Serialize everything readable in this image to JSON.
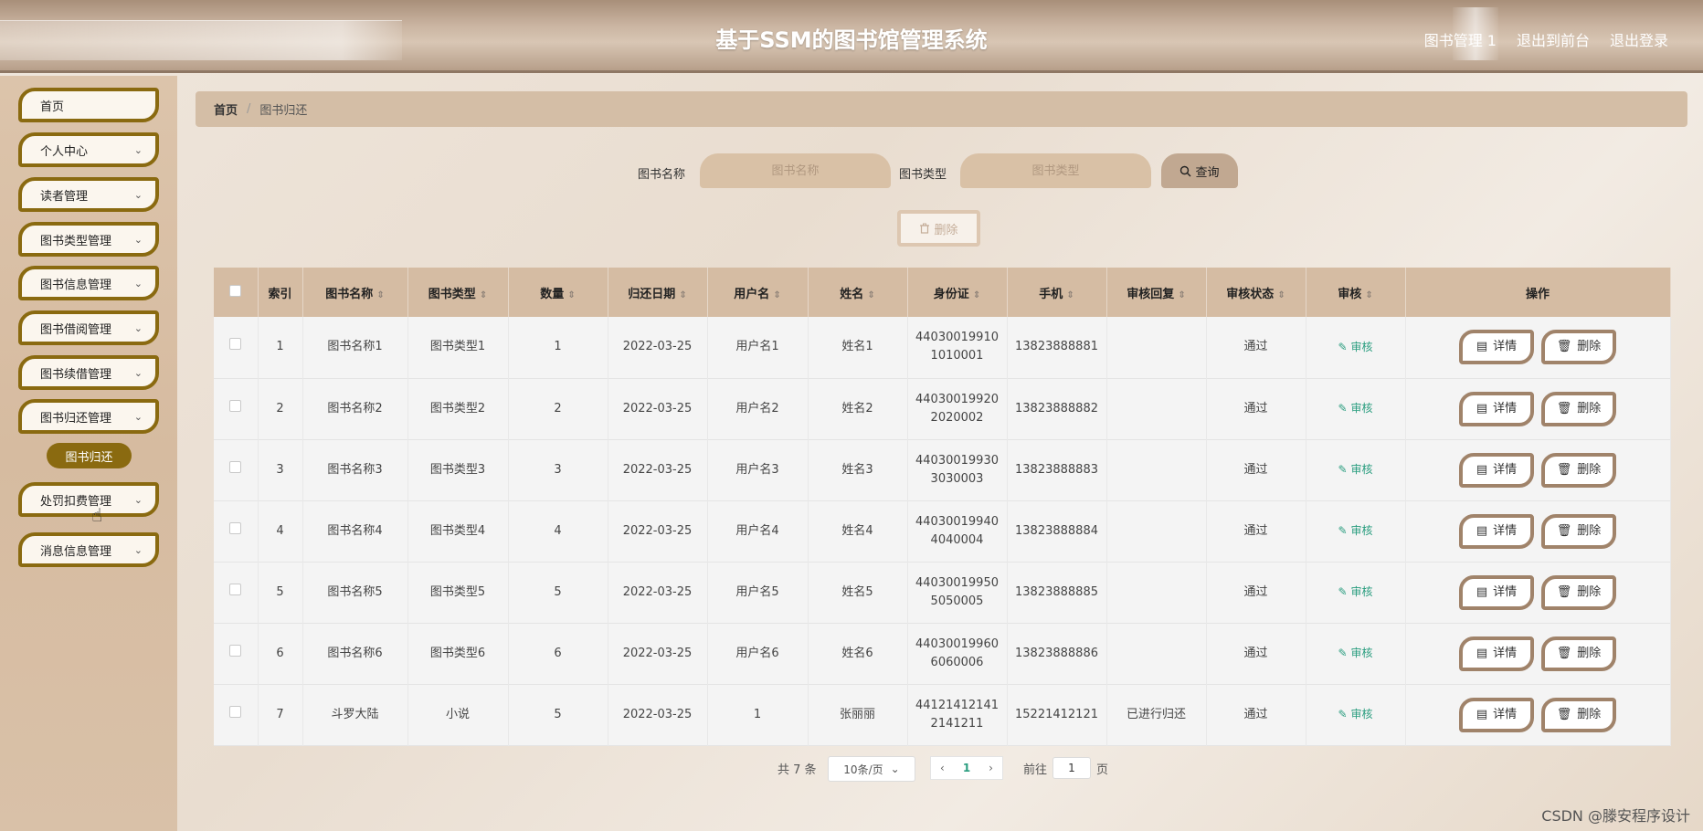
{
  "header": {
    "title": "基于SSM的图书馆管理系统",
    "links": [
      "图书管理 1",
      "退出到前台",
      "退出登录"
    ]
  },
  "sidebar": {
    "items": [
      {
        "label": "首页",
        "has_chevron": false
      },
      {
        "label": "个人中心",
        "has_chevron": true
      },
      {
        "label": "读者管理",
        "has_chevron": true
      },
      {
        "label": "图书类型管理",
        "has_chevron": true
      },
      {
        "label": "图书信息管理",
        "has_chevron": true
      },
      {
        "label": "图书借阅管理",
        "has_chevron": true
      },
      {
        "label": "图书续借管理",
        "has_chevron": true
      },
      {
        "label": "图书归还管理",
        "has_chevron": true
      },
      {
        "label": "处罚扣费管理",
        "has_chevron": true
      },
      {
        "label": "消息信息管理",
        "has_chevron": true
      }
    ],
    "active_sub_item": "图书归还"
  },
  "breadcrumb": {
    "home": "首页",
    "separator": "/",
    "current": "图书归还"
  },
  "search": {
    "book_name_label": "图书名称",
    "book_name_placeholder": "图书名称",
    "book_type_label": "图书类型",
    "book_type_placeholder": "图书类型",
    "query_label": "查询"
  },
  "toolbar": {
    "delete_label": "删除"
  },
  "table": {
    "headers": [
      "索引",
      "图书名称",
      "图书类型",
      "数量",
      "归还日期",
      "用户名",
      "姓名",
      "身份证",
      "手机",
      "审核回复",
      "审核状态",
      "审核",
      "操作"
    ],
    "audit_label": "审核",
    "detail_label": "详情",
    "delete_label": "删除",
    "rows": [
      {
        "index": "1",
        "book_name": "图书名称1",
        "book_type": "图书类型1",
        "qty": "1",
        "return_date": "2022-03-25",
        "username": "用户名1",
        "name": "姓名1",
        "id_line1": "44030019910",
        "id_line2": "1010001",
        "phone": "13823888881",
        "reply": "",
        "status": "通过"
      },
      {
        "index": "2",
        "book_name": "图书名称2",
        "book_type": "图书类型2",
        "qty": "2",
        "return_date": "2022-03-25",
        "username": "用户名2",
        "name": "姓名2",
        "id_line1": "44030019920",
        "id_line2": "2020002",
        "phone": "13823888882",
        "reply": "",
        "status": "通过"
      },
      {
        "index": "3",
        "book_name": "图书名称3",
        "book_type": "图书类型3",
        "qty": "3",
        "return_date": "2022-03-25",
        "username": "用户名3",
        "name": "姓名3",
        "id_line1": "44030019930",
        "id_line2": "3030003",
        "phone": "13823888883",
        "reply": "",
        "status": "通过"
      },
      {
        "index": "4",
        "book_name": "图书名称4",
        "book_type": "图书类型4",
        "qty": "4",
        "return_date": "2022-03-25",
        "username": "用户名4",
        "name": "姓名4",
        "id_line1": "44030019940",
        "id_line2": "4040004",
        "phone": "13823888884",
        "reply": "",
        "status": "通过"
      },
      {
        "index": "5",
        "book_name": "图书名称5",
        "book_type": "图书类型5",
        "qty": "5",
        "return_date": "2022-03-25",
        "username": "用户名5",
        "name": "姓名5",
        "id_line1": "44030019950",
        "id_line2": "5050005",
        "phone": "13823888885",
        "reply": "",
        "status": "通过"
      },
      {
        "index": "6",
        "book_name": "图书名称6",
        "book_type": "图书类型6",
        "qty": "6",
        "return_date": "2022-03-25",
        "username": "用户名6",
        "name": "姓名6",
        "id_line1": "44030019960",
        "id_line2": "6060006",
        "phone": "13823888886",
        "reply": "",
        "status": "通过"
      },
      {
        "index": "7",
        "book_name": "斗罗大陆",
        "book_type": "小说",
        "qty": "5",
        "return_date": "2022-03-25",
        "username": "1",
        "name": "张丽丽",
        "id_line1": "44121412141",
        "id_line2": "2141211",
        "phone": "15221412121",
        "reply": "已进行归还",
        "status": "通过"
      }
    ]
  },
  "pagination": {
    "total": "共 7 条",
    "page_size": "10条/页",
    "current_page": "1",
    "goto_label": "前往",
    "goto_value": "1",
    "page_suffix": "页"
  },
  "watermark": "CSDN @滕安程序设计",
  "colors": {
    "accent_gold": "#8a6a10",
    "header_tan": "#d5bca3",
    "audit_green": "#2a9d7f"
  }
}
